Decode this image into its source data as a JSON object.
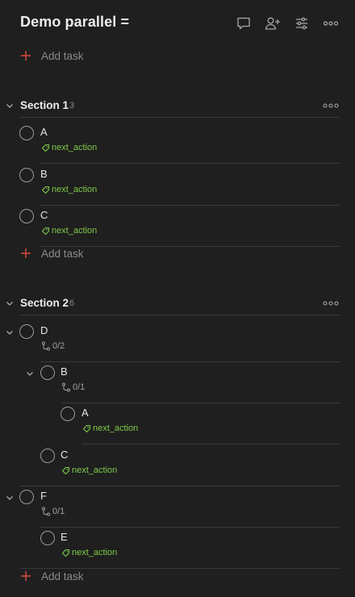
{
  "header": {
    "title": "Demo parallel =",
    "icons": [
      "comment-icon",
      "share-person-icon",
      "view-settings-icon",
      "more-icon"
    ]
  },
  "add_task_label": "Add task",
  "sections": [
    {
      "name": "Section 1",
      "count": "3",
      "tasks": [
        {
          "name": "A",
          "label": "next_action"
        },
        {
          "name": "B",
          "label": "next_action"
        },
        {
          "name": "C",
          "label": "next_action"
        }
      ]
    },
    {
      "name": "Section 2",
      "count": "6",
      "tasks": [
        {
          "name": "D",
          "subtasks": "0/2",
          "collapsible": true,
          "children": [
            {
              "name": "B",
              "subtasks": "0/1",
              "collapsible": true,
              "children": [
                {
                  "name": "A",
                  "label": "next_action"
                }
              ]
            },
            {
              "name": "C",
              "label": "next_action"
            }
          ]
        },
        {
          "name": "F",
          "subtasks": "0/1",
          "collapsible": true,
          "children": [
            {
              "name": "E",
              "label": "next_action"
            }
          ]
        }
      ]
    }
  ],
  "colors": {
    "background": "#1f1f1f",
    "accent_red": "#dc4c3e",
    "label_green": "#7ecb4a",
    "muted": "#8a8a8a"
  }
}
